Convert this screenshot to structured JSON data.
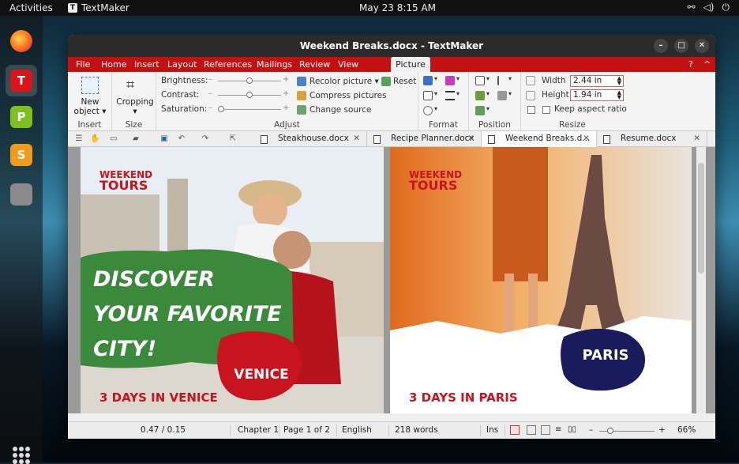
{
  "topbar": {
    "activities": "Activities",
    "app_name": "TextMaker",
    "clock": "May 23  8:15 AM"
  },
  "window": {
    "title": "Weekend Breaks.docx - TextMaker"
  },
  "menu": {
    "items": [
      "File",
      "Home",
      "Insert",
      "Layout",
      "References",
      "Mailings",
      "Review",
      "View"
    ],
    "active_tab": "Picture",
    "help": "?",
    "collapse": "^"
  },
  "ribbon": {
    "insert": {
      "new_object": "New object",
      "label": "Insert"
    },
    "size": {
      "cropping": "Cropping",
      "label": "Size"
    },
    "adjust": {
      "brightness": "Brightness:",
      "contrast": "Contrast:",
      "saturation": "Saturation:",
      "recolor": "Recolor picture",
      "compress": "Compress pictures",
      "change_source": "Change source",
      "reset": "Reset",
      "label": "Adjust"
    },
    "format": {
      "label": "Format"
    },
    "position": {
      "label": "Position"
    },
    "resize": {
      "width_label": "Width",
      "width_value": "2.44 in",
      "height_label": "Height",
      "height_value": "1.94 in",
      "keep_aspect": "Keep aspect ratio",
      "label": "Resize"
    }
  },
  "tabs": [
    {
      "label": "Steakhouse.docx",
      "active": false
    },
    {
      "label": "Recipe Planner.docx",
      "active": false
    },
    {
      "label": "Weekend Breaks.d...",
      "active": true
    },
    {
      "label": "Resume.docx",
      "active": false
    }
  ],
  "document": {
    "venice": {
      "brand_1": "WEEKEND",
      "brand_2": "TOURS",
      "headline_1": "DISCOVER",
      "headline_2": "YOUR FAVORITE",
      "headline_3": "CITY!",
      "badge": "VENICE",
      "footer": "3 DAYS IN VENICE"
    },
    "paris": {
      "brand_1": "WEEKEND",
      "brand_2": "TOURS",
      "badge": "PARIS",
      "footer": "3 DAYS IN PARIS"
    }
  },
  "status": {
    "position": "0.47 / 0.15",
    "chapter": "Chapter 1",
    "page": "Page 1 of 2",
    "language": "English",
    "words": "218 words",
    "mode": "Ins",
    "zoom": "66%"
  },
  "colors": {
    "accent": "#c41010",
    "green": "#3b8a3b",
    "venice_red": "#c8141e",
    "paris_navy": "#1a1b5c"
  }
}
